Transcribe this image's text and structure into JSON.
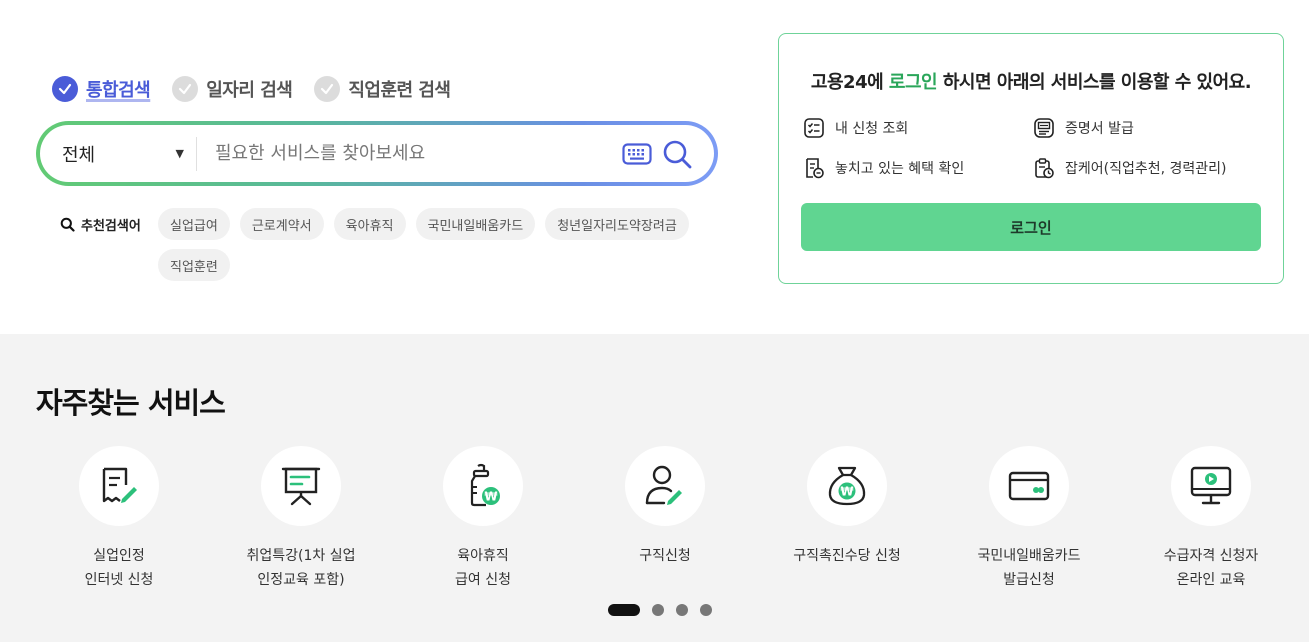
{
  "search": {
    "tabs": [
      {
        "label": "통합검색",
        "active": true
      },
      {
        "label": "일자리 검색",
        "active": false
      },
      {
        "label": "직업훈련 검색",
        "active": false
      }
    ],
    "scope": "전체",
    "placeholder": "필요한 서비스를 찾아보세요"
  },
  "recommended": {
    "title": "추천검색어",
    "keywords": [
      "실업급여",
      "근로계약서",
      "육아휴직",
      "국민내일배움카드",
      "청년일자리도약장려금",
      "직업훈련"
    ]
  },
  "login_box": {
    "heading_prefix": "고용24에 ",
    "heading_highlight": "로그인",
    "heading_suffix": " 하시면 아래의 서비스를 이용할 수 있어요.",
    "services": [
      {
        "label": "내 신청 조회",
        "icon": "checklist-icon"
      },
      {
        "label": "증명서 발급",
        "icon": "certificate-icon"
      },
      {
        "label": "놓치고 있는 혜택 확인",
        "icon": "benefit-check-icon"
      },
      {
        "label": "잡케어(직업추천, 경력관리)",
        "icon": "jobcare-icon"
      }
    ],
    "button": "로그인"
  },
  "frequent": {
    "title": "자주찾는 서비스",
    "items": [
      {
        "label": "실업인정\n인터넷 신청",
        "icon": "document-edit-icon"
      },
      {
        "label": "취업특강(1차 실업\n인정교육 포함)",
        "icon": "presentation-board-icon"
      },
      {
        "label": "육아휴직\n급여 신청",
        "icon": "baby-bottle-icon"
      },
      {
        "label": "구직신청",
        "icon": "person-edit-icon"
      },
      {
        "label": "구직촉진수당 신청",
        "icon": "money-bag-icon"
      },
      {
        "label": "국민내일배움카드\n발급신청",
        "icon": "card-icon"
      },
      {
        "label": "수급자격 신청자\n온라인 교육",
        "icon": "monitor-play-icon"
      }
    ],
    "pagination": {
      "total": 4,
      "current": 1
    }
  },
  "colors": {
    "accent_blue": "#4a5cd8",
    "accent_green": "#60d591",
    "highlight_green": "#2aa65a"
  }
}
